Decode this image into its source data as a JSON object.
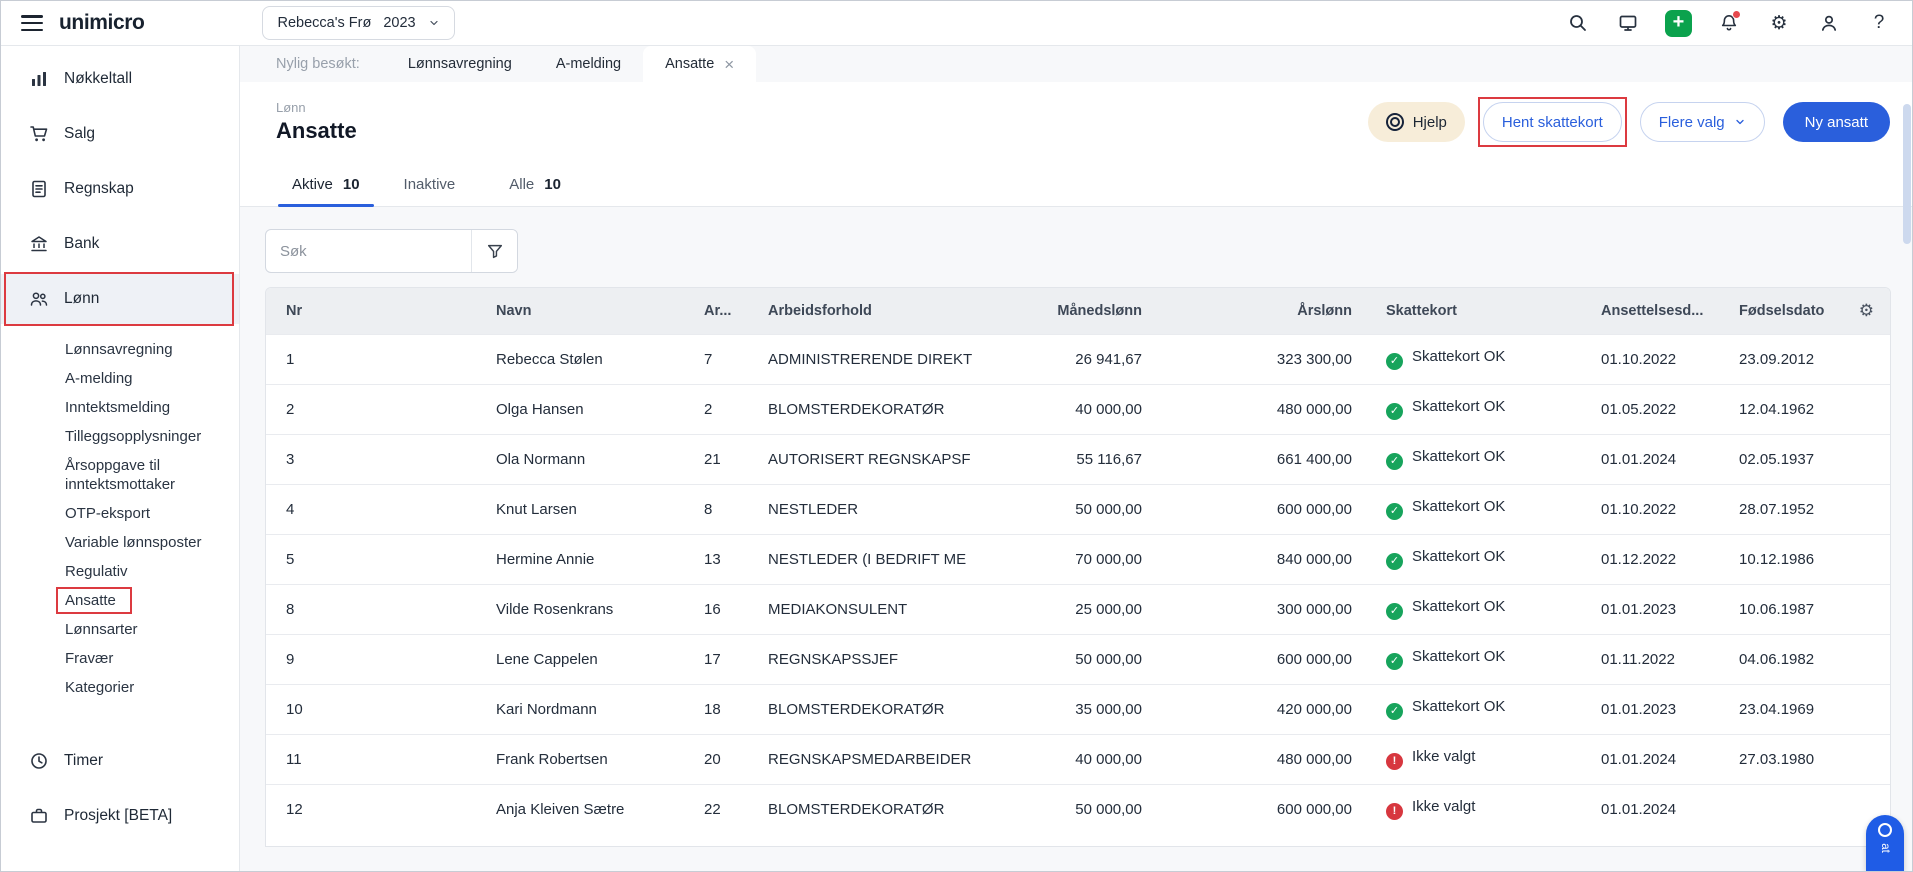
{
  "topbar": {
    "logo_text": "unimicro",
    "company_name": "Rebecca's Frø",
    "company_year": "2023"
  },
  "sidebar": {
    "items": [
      {
        "label": "Nøkkeltall"
      },
      {
        "label": "Salg"
      },
      {
        "label": "Regnskap"
      },
      {
        "label": "Bank"
      },
      {
        "label": "Lønn"
      },
      {
        "label": "Timer"
      },
      {
        "label": "Prosjekt [BETA]"
      }
    ],
    "lonn_children": [
      {
        "label": "Lønnsavregning"
      },
      {
        "label": "A-melding"
      },
      {
        "label": "Inntektsmelding"
      },
      {
        "label": "Tilleggsopplysninger"
      },
      {
        "label": "Årsoppgave til inntektsmottaker"
      },
      {
        "label": "OTP-eksport"
      },
      {
        "label": "Variable lønnsposter"
      },
      {
        "label": "Regulativ"
      },
      {
        "label": "Ansatte"
      },
      {
        "label": "Lønnsarter"
      },
      {
        "label": "Fravær"
      },
      {
        "label": "Kategorier"
      }
    ]
  },
  "tabstrip": {
    "recent_label": "Nylig besøkt:",
    "tabs": [
      {
        "label": "Lønnsavregning"
      },
      {
        "label": "A-melding"
      },
      {
        "label": "Ansatte"
      }
    ],
    "close_glyph": "×"
  },
  "header": {
    "breadcrumb": "Lønn",
    "title": "Ansatte",
    "help_label": "Hjelp",
    "hent_skattekort_label": "Hent skattekort",
    "flere_valg_label": "Flere valg",
    "ny_ansatt_label": "Ny ansatt"
  },
  "view_tabs": [
    {
      "label": "Aktive",
      "count": "10"
    },
    {
      "label": "Inaktive",
      "count": ""
    },
    {
      "label": "Alle",
      "count": "10"
    }
  ],
  "search": {
    "placeholder": "Søk"
  },
  "table": {
    "columns": [
      "Nr",
      "Navn",
      "Ar...",
      "Arbeidsforhold",
      "Månedslønn",
      "Årslønn",
      "Skattekort",
      "Ansettelsesd...",
      "Fødselsdato"
    ],
    "rows": [
      {
        "nr": "1",
        "navn": "Rebecca Stølen",
        "ar": "7",
        "arbeidsforhold": "ADMINISTRERENDE DIREKT",
        "manedslonn": "26 941,67",
        "arslonn": "323 300,00",
        "state": "ok",
        "skattekort": "Skattekort OK",
        "ansettelse": "01.10.2022",
        "fodsel": "23.09.2012"
      },
      {
        "nr": "2",
        "navn": "Olga Hansen",
        "ar": "2",
        "arbeidsforhold": "BLOMSTERDEKORATØR",
        "manedslonn": "40 000,00",
        "arslonn": "480 000,00",
        "state": "ok",
        "skattekort": "Skattekort OK",
        "ansettelse": "01.05.2022",
        "fodsel": "12.04.1962"
      },
      {
        "nr": "3",
        "navn": "Ola Normann",
        "ar": "21",
        "arbeidsforhold": "AUTORISERT REGNSKAPSF",
        "manedslonn": "55 116,67",
        "arslonn": "661 400,00",
        "state": "ok",
        "skattekort": "Skattekort OK",
        "ansettelse": "01.01.2024",
        "fodsel": "02.05.1937"
      },
      {
        "nr": "4",
        "navn": "Knut Larsen",
        "ar": "8",
        "arbeidsforhold": "NESTLEDER",
        "manedslonn": "50 000,00",
        "arslonn": "600 000,00",
        "state": "ok",
        "skattekort": "Skattekort OK",
        "ansettelse": "01.10.2022",
        "fodsel": "28.07.1952"
      },
      {
        "nr": "5",
        "navn": "Hermine Annie",
        "ar": "13",
        "arbeidsforhold": "NESTLEDER (I BEDRIFT ME",
        "manedslonn": "70 000,00",
        "arslonn": "840 000,00",
        "state": "ok",
        "skattekort": "Skattekort OK",
        "ansettelse": "01.12.2022",
        "fodsel": "10.12.1986"
      },
      {
        "nr": "8",
        "navn": "Vilde Rosenkrans",
        "ar": "16",
        "arbeidsforhold": "MEDIAKONSULENT",
        "manedslonn": "25 000,00",
        "arslonn": "300 000,00",
        "state": "ok",
        "skattekort": "Skattekort OK",
        "ansettelse": "01.01.2023",
        "fodsel": "10.06.1987"
      },
      {
        "nr": "9",
        "navn": "Lene Cappelen",
        "ar": "17",
        "arbeidsforhold": "REGNSKAPSSJEF",
        "manedslonn": "50 000,00",
        "arslonn": "600 000,00",
        "state": "ok",
        "skattekort": "Skattekort OK",
        "ansettelse": "01.11.2022",
        "fodsel": "04.06.1982"
      },
      {
        "nr": "10",
        "navn": "Kari Nordmann",
        "ar": "18",
        "arbeidsforhold": "BLOMSTERDEKORATØR",
        "manedslonn": "35 000,00",
        "arslonn": "420 000,00",
        "state": "ok",
        "skattekort": "Skattekort OK",
        "ansettelse": "01.01.2023",
        "fodsel": "23.04.1969"
      },
      {
        "nr": "11",
        "navn": "Frank Robertsen",
        "ar": "20",
        "arbeidsforhold": "REGNSKAPSMEDARBEIDER",
        "manedslonn": "40 000,00",
        "arslonn": "480 000,00",
        "state": "missing",
        "skattekort": "Ikke valgt",
        "ansettelse": "01.01.2024",
        "fodsel": "27.03.1980"
      },
      {
        "nr": "12",
        "navn": "Anja Kleiven Sætre",
        "ar": "22",
        "arbeidsforhold": "BLOMSTERDEKORATØR",
        "manedslonn": "50 000,00",
        "arslonn": "600 000,00",
        "state": "missing",
        "skattekort": "Ikke valgt",
        "ansettelse": "01.01.2024",
        "fodsel": ""
      }
    ]
  },
  "chat": {
    "visible_label": "at"
  },
  "colors": {
    "primary_blue": "#2a5fdc",
    "status_green": "#17a45c",
    "status_red": "#d7373f",
    "annotation_red": "#dc3a40",
    "help_button_bg": "#f7edd9"
  }
}
